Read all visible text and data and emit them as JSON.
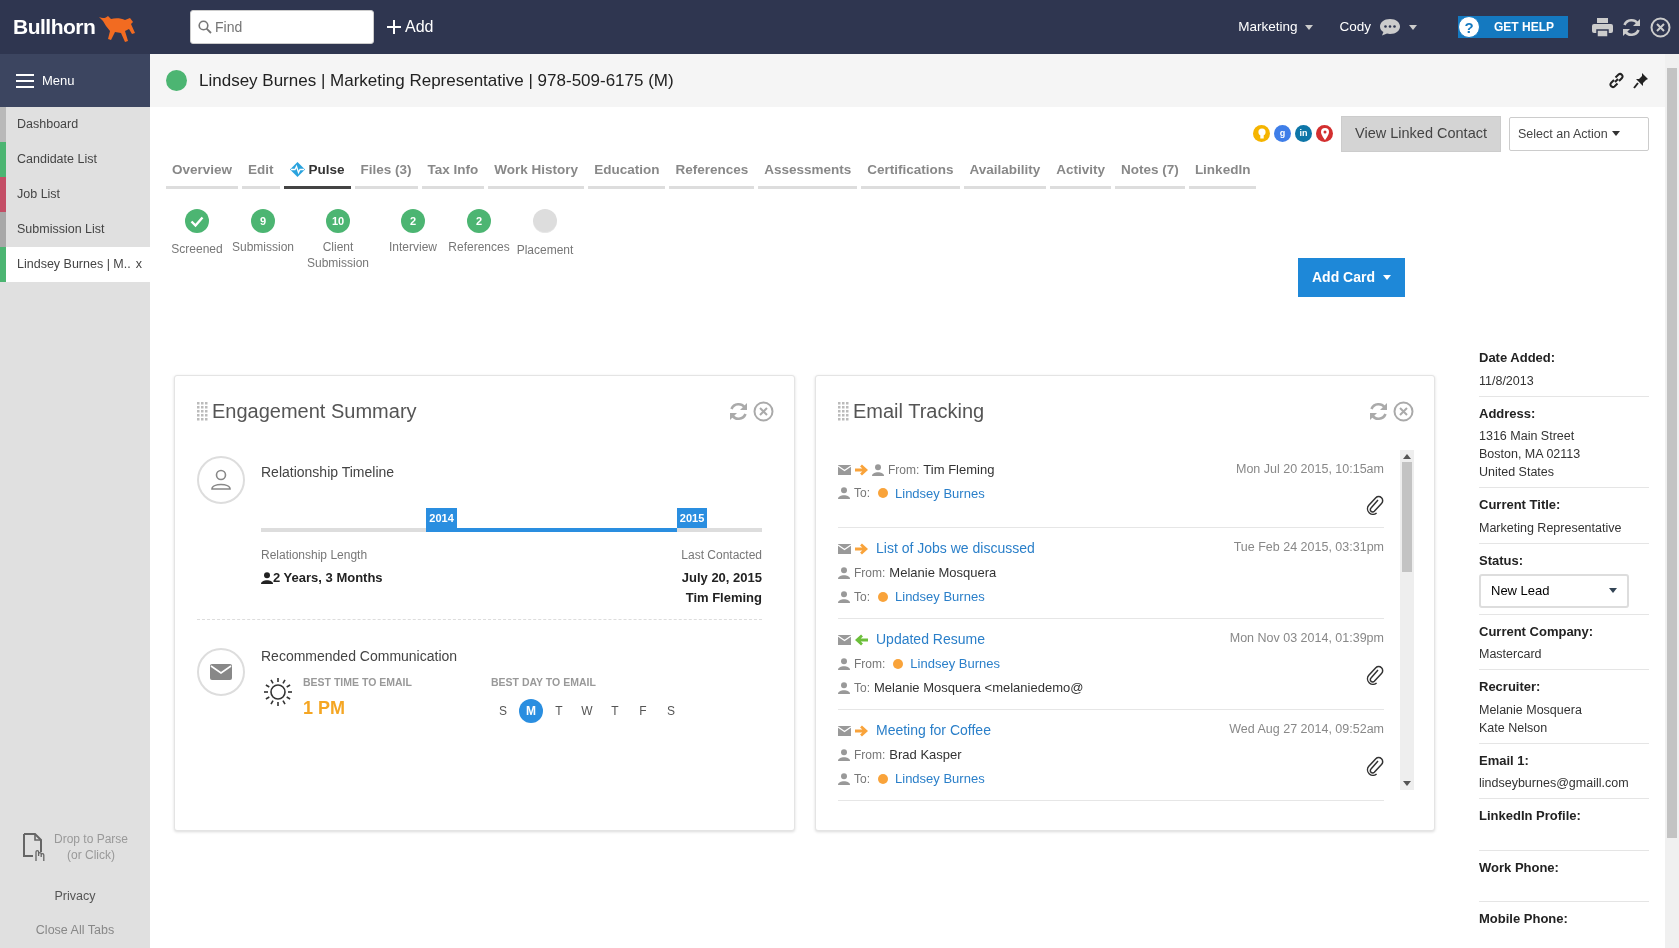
{
  "topbar": {
    "logo": "Bullhorn",
    "search": {
      "placeholder": "Find"
    },
    "add": "Add",
    "menus": [
      "Marketing",
      "Cody"
    ],
    "help": {
      "glyph": "?",
      "label": "GET HELP"
    }
  },
  "sidebar": {
    "menu_label": "Menu",
    "items": [
      {
        "label": "Dashboard",
        "color": "#b9b9b9",
        "selected": false
      },
      {
        "label": "Candidate List",
        "color": "#4cb572",
        "selected": false
      },
      {
        "label": "Job List",
        "color": "#c44e66",
        "selected": false
      },
      {
        "label": "Submission List",
        "color": "#a8a8a8",
        "selected": false
      },
      {
        "label": "Lindsey Burnes | M..",
        "color": "#4cb572",
        "selected": true,
        "close": "x"
      }
    ],
    "drop_to_parse": [
      "Drop to Parse",
      "(or Click)"
    ],
    "privacy": "Privacy",
    "close_all": "Close All Tabs"
  },
  "record": {
    "title": "Lindsey Burnes | Marketing Representative | 978-509-6175 (M)"
  },
  "social": [
    {
      "kind": "bulb",
      "color": "#f5b400"
    },
    {
      "kind": "letter",
      "glyph": "g",
      "color": "#3f7ee8"
    },
    {
      "kind": "letter",
      "glyph": "in",
      "color": "#0e76a8"
    },
    {
      "kind": "pin",
      "color": "#d32f2f"
    }
  ],
  "view_linked": "View Linked Contact",
  "select_action": "Select an Action",
  "tabs": [
    {
      "kind": "plain",
      "label": "Overview",
      "selected": false
    },
    {
      "kind": "plain",
      "label": "Edit",
      "selected": false
    },
    {
      "kind": "pulse",
      "label": "Pulse",
      "selected": true
    },
    {
      "kind": "plain",
      "label": "Files (3)",
      "selected": false
    },
    {
      "kind": "plain",
      "label": "Tax Info",
      "selected": false
    },
    {
      "kind": "plain",
      "label": "Work History",
      "selected": false
    },
    {
      "kind": "plain",
      "label": "Education",
      "selected": false
    },
    {
      "kind": "plain",
      "label": "References",
      "selected": false
    },
    {
      "kind": "plain",
      "label": "Assessments",
      "selected": false
    },
    {
      "kind": "plain",
      "label": "Certifications",
      "selected": false
    },
    {
      "kind": "plain",
      "label": "Availability",
      "selected": false
    },
    {
      "kind": "plain",
      "label": "Activity",
      "selected": false
    },
    {
      "kind": "plain",
      "label": "Notes (7)",
      "selected": false
    },
    {
      "kind": "plain",
      "label": "LinkedIn",
      "selected": false
    }
  ],
  "pipeline": [
    {
      "kind": "check",
      "label": "Screened"
    },
    {
      "kind": "count",
      "count": "9",
      "label": "Submission"
    },
    {
      "kind": "count",
      "count": "10",
      "label": "Client Submission"
    },
    {
      "kind": "count",
      "count": "2",
      "label": "Interview"
    },
    {
      "kind": "count",
      "count": "2",
      "label": "References"
    },
    {
      "kind": "empty",
      "label": "Placement"
    }
  ],
  "add_card": "Add Card",
  "engagement": {
    "title": "Engagement Summary",
    "timeline_title": "Relationship Timeline",
    "markers": [
      {
        "label": "2014",
        "level": 0.33
      },
      {
        "label": "2015",
        "level": 0.83
      }
    ],
    "length_label": "Relationship Length",
    "length_value": "2 Years, 3 Months",
    "last_label": "Last Contacted",
    "last_date": "July 20, 2015",
    "last_by": "Tim Fleming",
    "comm_title": "Recommended Communication",
    "time_label": "BEST TIME TO EMAIL",
    "time_value": "1 PM",
    "day_label": "BEST DAY TO EMAIL",
    "days": [
      {
        "label": "S",
        "selected": false
      },
      {
        "label": "M",
        "selected": true
      },
      {
        "label": "T",
        "selected": false
      },
      {
        "label": "W",
        "selected": false
      },
      {
        "label": "T",
        "selected": false
      },
      {
        "label": "F",
        "selected": false
      },
      {
        "label": "S",
        "selected": false
      }
    ]
  },
  "email_tracking": {
    "title": "Email Tracking",
    "emails": [
      {
        "kind": "outgoing",
        "from": {
          "label": "From:",
          "name": "Tim Fleming",
          "linked": false
        },
        "to": {
          "label": "To:",
          "name": "Lindsey Burnes",
          "linked": true
        },
        "date": "Mon Jul 20 2015, 10:15am",
        "attachment": true
      },
      {
        "kind": "outgoing",
        "subject": "List of Jobs we discussed",
        "from": {
          "label": "From:",
          "name": "Melanie Mosquera",
          "linked": false
        },
        "to": {
          "label": "To:",
          "name": "Lindsey Burnes",
          "linked": true
        },
        "date": "Tue Feb 24 2015, 03:31pm",
        "attachment": false
      },
      {
        "kind": "incoming",
        "subject": "Updated Resume",
        "from": {
          "label": "From:",
          "name": "Lindsey Burnes",
          "linked": true
        },
        "to": {
          "label": "To:",
          "name": "Melanie Mosquera <melaniedemo@",
          "linked": false
        },
        "date": "Mon Nov 03 2014, 01:39pm",
        "attachment": true
      },
      {
        "kind": "outgoing",
        "subject": "Meeting for Coffee",
        "from": {
          "label": "From:",
          "name": "Brad Kasper",
          "linked": false
        },
        "to": {
          "label": "To:",
          "name": "Lindsey Burnes",
          "linked": true
        },
        "date": "Wed Aug 27 2014, 09:52am",
        "attachment": true
      }
    ]
  },
  "details": [
    {
      "kind": "text",
      "label": "Date Added:",
      "values": [
        "11/8/2013"
      ]
    },
    {
      "kind": "text",
      "label": "Address:",
      "values": [
        "1316 Main Street",
        "Boston, MA 02113",
        "United States"
      ]
    },
    {
      "kind": "text",
      "label": "Current Title:",
      "values": [
        "Marketing Representative"
      ]
    },
    {
      "kind": "select",
      "label": "Status:",
      "values": [
        "New Lead"
      ]
    },
    {
      "kind": "text",
      "label": "Current Company:",
      "values": [
        "Mastercard"
      ]
    },
    {
      "kind": "text",
      "label": "Recruiter:",
      "values": [
        "Melanie Mosquera",
        "Kate Nelson"
      ]
    },
    {
      "kind": "link",
      "label": "Email 1:",
      "values": [
        "lindseyburnes@gmaill.com"
      ]
    },
    {
      "kind": "text",
      "label": "LinkedIn Profile:"
    },
    {
      "kind": "text",
      "label": "Work Phone:"
    },
    {
      "kind": "text",
      "label": "Mobile Phone:"
    }
  ]
}
